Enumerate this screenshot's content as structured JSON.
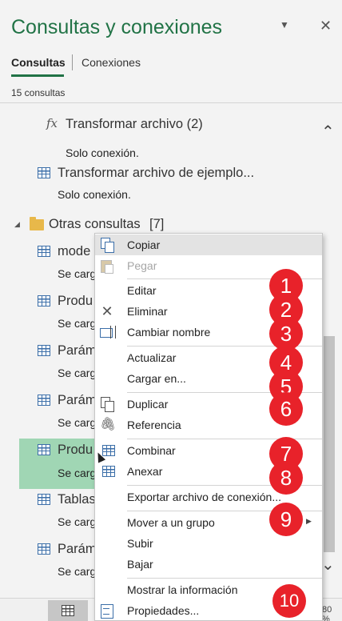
{
  "pane": {
    "title": "Consultas y conexiones",
    "dropdown_icon": "▼",
    "close_icon": "✕"
  },
  "tabs": {
    "queries": "Consultas",
    "connections": "Conexiones"
  },
  "query_count": "15 consultas",
  "list": {
    "items": [
      {
        "name": "Transformar archivo (2)",
        "sub": "Solo conexión.",
        "icon": "function-icon"
      },
      {
        "name": "Transformar archivo de ejemplo...",
        "sub": "Solo conexión.",
        "icon": "table-icon"
      }
    ],
    "group": {
      "name": "Otras consultas",
      "count": "[7]"
    },
    "group_items": [
      {
        "name": "mode",
        "sub": "Se carg"
      },
      {
        "name": "Produ",
        "sub": "Se carg"
      },
      {
        "name": "Parám",
        "sub": "Se carg"
      },
      {
        "name": "Parám",
        "sub": "Se carg"
      },
      {
        "name": "Produ",
        "sub": "Se carg"
      },
      {
        "name": "Tablas",
        "sub": "Se carg"
      },
      {
        "name": "Parám",
        "sub": "Se carg"
      }
    ]
  },
  "menu": {
    "copy": "Copiar",
    "paste": "Pegar",
    "edit": "Editar",
    "delete": "Eliminar",
    "rename": "Cambiar nombre",
    "refresh": "Actualizar",
    "load_to": "Cargar en...",
    "duplicate": "Duplicar",
    "reference": "Referencia",
    "merge": "Combinar",
    "append": "Anexar",
    "export": "Exportar archivo de conexión...",
    "move_group": "Mover a un grupo",
    "move_up": "Subir",
    "move_down": "Bajar",
    "show_info": "Mostrar la información",
    "properties": "Propiedades..."
  },
  "badges": [
    "1",
    "2",
    "3",
    "4",
    "5",
    "6",
    "7",
    "8",
    "9",
    "10"
  ],
  "status": {
    "zoom": "80 %"
  },
  "colors": {
    "accent": "#217346",
    "badge": "#e8222a",
    "selected": "#a0d6b4"
  }
}
